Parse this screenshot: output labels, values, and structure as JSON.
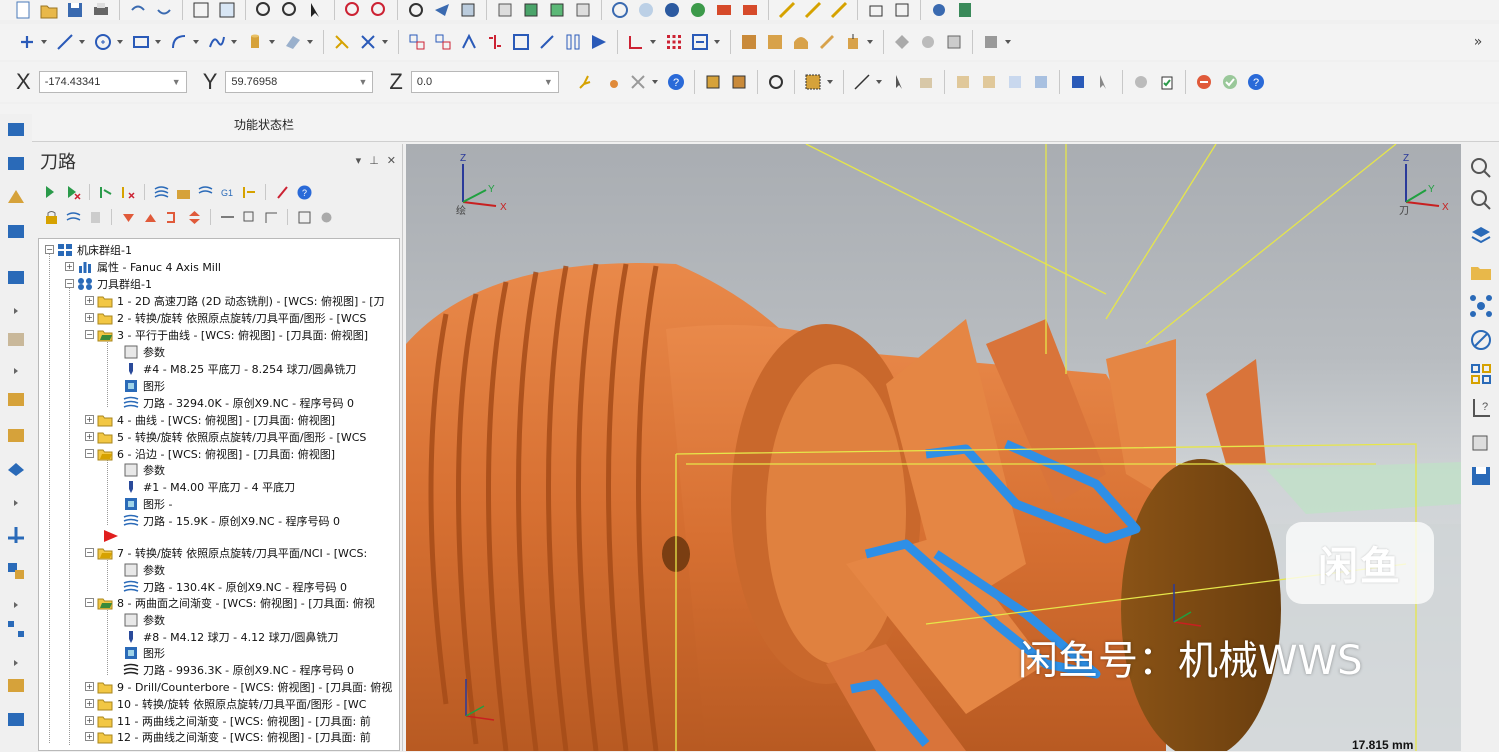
{
  "coordinates": {
    "x_label": "X",
    "x_value": "-174.43341",
    "y_label": "Y",
    "y_value": "59.76958",
    "z_label": "Z",
    "z_value": "0.0"
  },
  "status_bar": {
    "label": "功能状态栏"
  },
  "toolpath_panel": {
    "title": "刀路",
    "controls": [
      "▾",
      "⊥",
      "✕"
    ]
  },
  "tree": {
    "root": "机床群组-1",
    "properties": "属性 - Fanuc 4 Axis Mill",
    "toolgroup": "刀具群组-1",
    "op1": "1 - 2D 高速刀路 (2D 动态铣削) - [WCS: 俯视图] - [刀",
    "op2": "2 - 转换/旋转 依照原点旋转/刀具平面/图形 - [WCS",
    "op3": "3 - 平行于曲线 - [WCS: 俯视图] - [刀具面: 俯视图]",
    "op3_params": "参数",
    "op3_tool": "#4 - M8.25 平底刀 - 8.254 球刀/圆鼻铣刀",
    "op3_geom": "图形",
    "op3_path": "刀路 - 3294.0K - 原创X9.NC - 程序号码 0",
    "op4": "4 - 曲线 - [WCS: 俯视图] - [刀具面: 俯视图]",
    "op5": "5 - 转换/旋转 依照原点旋转/刀具平面/图形 - [WCS",
    "op6": "6 - 沿边 - [WCS: 俯视图] - [刀具面: 俯视图]",
    "op6_params": "参数",
    "op6_tool": "#1 - M4.00 平底刀 - 4 平底刀",
    "op6_geom": "图形 -",
    "op6_path": "刀路 - 15.9K - 原创X9.NC - 程序号码 0",
    "op7": "7 - 转换/旋转 依照原点旋转/刀具平面/NCI - [WCS:",
    "op7_params": "参数",
    "op7_path": "刀路 - 130.4K - 原创X9.NC - 程序号码 0",
    "op8": "8 - 两曲面之间渐变 - [WCS: 俯视图] - [刀具面: 俯视",
    "op8_params": "参数",
    "op8_tool": "#8 - M4.12 球刀 - 4.12 球刀/圆鼻铣刀",
    "op8_geom": "图形",
    "op8_path": "刀路 - 9936.3K - 原创X9.NC - 程序号码 0",
    "op9": "9 - Drill/Counterbore - [WCS: 俯视图] - [刀具面: 俯视",
    "op10": "10 - 转换/旋转 依照原点旋转/刀具平面/图形 - [WC",
    "op11": "11 - 两曲线之间渐变 - [WCS: 俯视图] - [刀具面: 前",
    "op12": "12 - 两曲线之间渐变 - [WCS: 俯视图] - [刀具面: 前"
  },
  "viewport": {
    "gizmo_left_label": "绘",
    "gizmo_right_label": "刀",
    "axis_x": "X",
    "axis_y": "Y",
    "axis_z": "Z",
    "scale": "17.815 mm"
  },
  "watermark": {
    "logo": "闲鱼",
    "text": "闲鱼号：机械WWS"
  },
  "colors": {
    "part_orange": "#d9743a",
    "toolpath_yellow": "#e6e64a",
    "toolpath_blue": "#2e8fe6",
    "background_grey": "#b4b8bc"
  }
}
